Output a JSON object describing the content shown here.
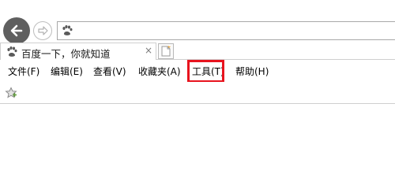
{
  "navigation": {
    "back_icon": "arrow-left-icon",
    "forward_icon": "arrow-right-icon",
    "address_value": "",
    "address_favicon": "baidu-paw-icon"
  },
  "tab": {
    "title": "百度一下，你就知道",
    "close_label": "×",
    "favicon": "baidu-paw-icon"
  },
  "menu": {
    "items": [
      {
        "label": "文件(F)"
      },
      {
        "label": "编辑(E)"
      },
      {
        "label": "查看(V)"
      },
      {
        "label": "收藏夹(A)"
      },
      {
        "label": "工具(T)"
      },
      {
        "label": "帮助(H)"
      }
    ],
    "highlighted_item": "工具(T)",
    "highlight_color": "#e8141e"
  },
  "favorites_bar": {
    "icon": "add-favorite-star-icon"
  }
}
